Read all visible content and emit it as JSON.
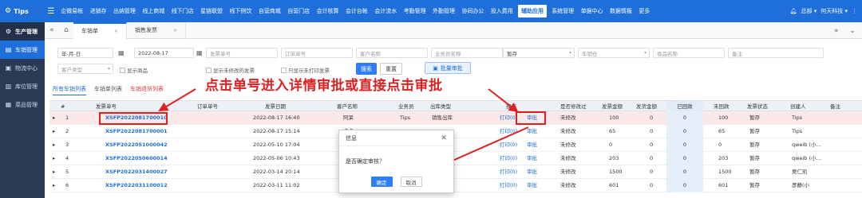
{
  "topbar": {
    "brand": "Tips",
    "nav": [
      "企微易帐",
      "进销存",
      "出纳管理",
      "线上商城",
      "线下门店",
      "星链联盟",
      "线下例饮",
      "自营商城",
      "自营门店",
      "会计核算",
      "会计台帐",
      "会计流水",
      "考勤管理",
      "外勤管理",
      "协同办公",
      "投入费用",
      "辅助应用",
      "系统管理",
      "单据中心",
      "数据情报",
      "更多"
    ],
    "active_nav": "辅助应用",
    "right_user": "总部",
    "right_company": "何天科技"
  },
  "sidebar": {
    "items": [
      {
        "label": "生产管理",
        "icon": "gear-icon"
      },
      {
        "label": "车销管理",
        "icon": "truck-icon"
      },
      {
        "label": "物流中心",
        "icon": "box-icon"
      },
      {
        "label": "库位管理",
        "icon": "warehouse-icon"
      },
      {
        "label": "菜品管理",
        "icon": "dish-icon"
      }
    ],
    "active_index": 1
  },
  "tabs": [
    {
      "label": "车销单"
    },
    {
      "label": "销售发票"
    }
  ],
  "filters": {
    "date_from": "年-月-日",
    "date_to": "2022-08-17",
    "invoice_no": "发票单号",
    "order_no": "订单单号",
    "customer": "客户名称",
    "salesperson": "业务员名称",
    "status": "暂存",
    "warehouse": "车销仓",
    "product_name": "商品名称",
    "remark": "备注",
    "customer_type": "客户类型",
    "show_products": "显示商品",
    "show_unmodified": "显示未修改的发票",
    "only_unprinted": "只显示未打印发票",
    "search_btn": "搜索",
    "reset_btn": "重置",
    "batch_approve_btn": "批量审批"
  },
  "subtabs": [
    "所有车销列表",
    "车销单列表",
    "车销退货列表"
  ],
  "annotation": "点击单号进入详情审批或直接点击审批",
  "table": {
    "headers": [
      "#",
      "发票单号",
      "订单单号",
      "发票日期",
      "客户名称",
      "业务员",
      "出库类型",
      "操作",
      "是否修改过",
      "发票金额",
      "发货金额",
      "已回款",
      "未回款",
      "发票状态",
      "创建人",
      "备注"
    ],
    "rows": [
      {
        "n": "1",
        "inv": "XSFP2022081700010",
        "date": "2022-08-17 16:40",
        "cust": "阿呆",
        "sp": "Tips",
        "type": "销售出库",
        "print": "打印(0)",
        "approve": "审批",
        "mod": "未修改",
        "amt": "100",
        "ship": "0",
        "paid": "0",
        "unpaid": "100",
        "status": "暂存",
        "creator": "Tips"
      },
      {
        "n": "2",
        "inv": "XSFP2022081700001",
        "date": "2022-08-17 15:14",
        "cust": "卡卡",
        "sp": "",
        "type": "",
        "print": "打印(0)",
        "approve": "审批",
        "mod": "未修改",
        "amt": "65",
        "ship": "0",
        "paid": "0",
        "unpaid": "65",
        "status": "暂存",
        "creator": "Tips"
      },
      {
        "n": "3",
        "inv": "XSFP2022051000042",
        "date": "2022-05-10 17:04",
        "cust": "嘉",
        "sp": "",
        "type": "",
        "print": "打印(0)",
        "approve": "审批",
        "mod": "未修改",
        "amt": "0",
        "ship": "0",
        "paid": "0",
        "unpaid": "0",
        "status": "暂存",
        "creator": "qweib (小…"
      },
      {
        "n": "4",
        "inv": "XSFP2022050600014",
        "date": "2022-05-06 10:43",
        "cust": "一",
        "sp": "",
        "type": "",
        "print": "打印(0)",
        "approve": "审批",
        "mod": "未修改",
        "amt": "203",
        "ship": "0",
        "paid": "0",
        "unpaid": "203",
        "status": "暂存",
        "creator": "qweib (小…"
      },
      {
        "n": "5",
        "inv": "XSFP2022031400027",
        "date": "2022-03-14 20:14",
        "cust": "北京望京",
        "sp": "",
        "type": "",
        "print": "打印(0)",
        "approve": "审批",
        "mod": "未修改",
        "amt": "1500",
        "ship": "0",
        "paid": "0",
        "unpaid": "1500",
        "status": "暂存",
        "creator": "吴仁凯"
      },
      {
        "n": "6",
        "inv": "XSFP2022031100012",
        "date": "2022-03-11 11:02",
        "cust": "",
        "sp": "",
        "type": "",
        "print": "打印(0)",
        "approve": "审批",
        "mod": "未修改",
        "amt": "601",
        "ship": "0",
        "paid": "0",
        "unpaid": "601",
        "status": "暂存",
        "creator": "彦静(小"
      }
    ]
  },
  "dialog": {
    "title": "信息",
    "message": "是否确定审核？",
    "ok": "确定",
    "cancel": "取消"
  },
  "colors": {
    "brand": "#1e6fd9",
    "sidebar": "#2a3a55",
    "annotation": "#e02020"
  }
}
